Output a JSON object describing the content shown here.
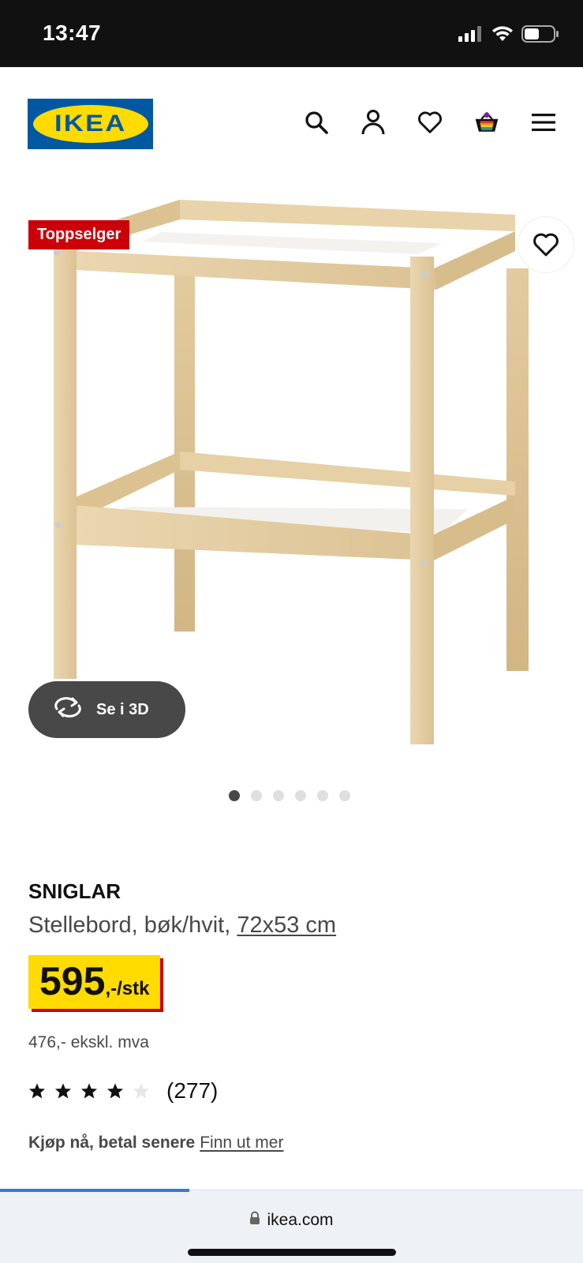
{
  "status_bar": {
    "time": "13:47",
    "icons": [
      "signal-icon",
      "wifi-icon",
      "battery-icon"
    ]
  },
  "header": {
    "logo_text": "IKEA",
    "nav_icons": [
      "search-icon",
      "account-icon",
      "favorites-icon",
      "cart-icon",
      "menu-icon"
    ],
    "brand_colors": {
      "blue": "#0058a3",
      "yellow": "#ffdb00"
    }
  },
  "gallery": {
    "badge": "Toppselger",
    "view3d_label": "Se i 3D",
    "dots_total": 6,
    "active_dot": 1
  },
  "product": {
    "name": "SNIGLAR",
    "description": "Stellebord, bøk/hvit, ",
    "dimensions": "72x53 cm",
    "price": "595",
    "price_unit": ",-/stk",
    "price_ex_vat": "476,- ekskl. mva",
    "rating_value": 4,
    "rating_max": 5,
    "rating_count": "(277)",
    "bnpl_text": "Kjøp nå, betal senere",
    "bnpl_link": "Finn ut mer"
  },
  "browser": {
    "url": "ikea.com"
  },
  "colors": {
    "badge_red": "#cc0008",
    "price_yellow": "#ffdb00",
    "text_dark": "#111111",
    "text_grey": "#484848"
  }
}
